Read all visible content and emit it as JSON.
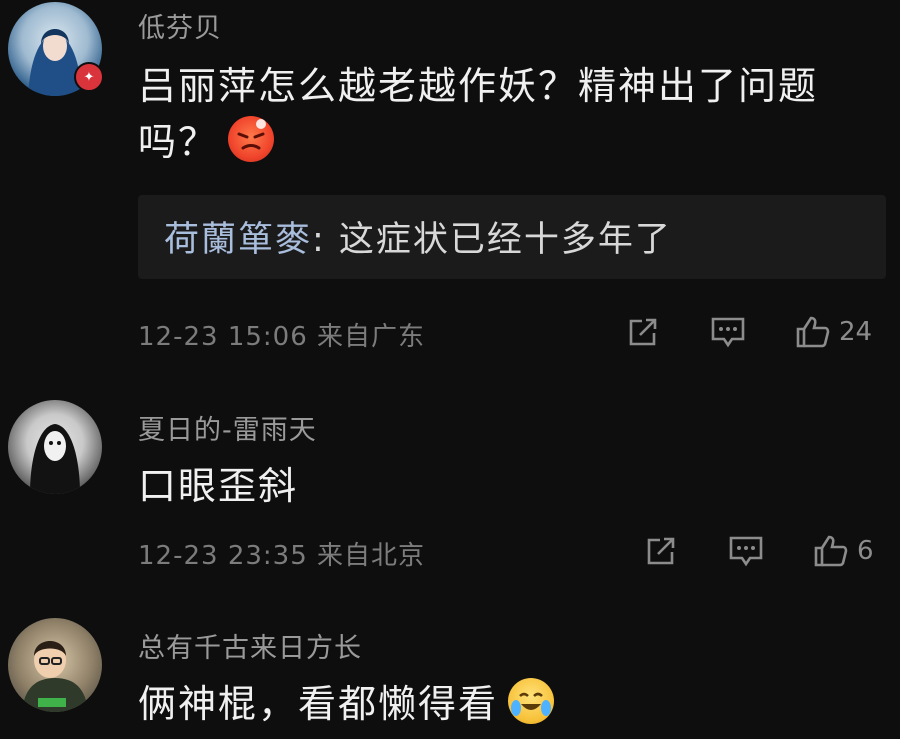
{
  "comments": [
    {
      "username": "低芬贝",
      "content": "吕丽萍怎么越老越作妖？精神出了问题吗？",
      "emoji": "angry-face-emoji",
      "reply": {
        "name": "荷蘭箪麥",
        "text": ": 这症状已经十多年了"
      },
      "time": "12-23 15:06",
      "location": "来自广东",
      "likes": "24"
    },
    {
      "username": "夏日的-雷雨天",
      "content": "口眼歪斜",
      "time": "12-23 23:35",
      "location": "来自北京",
      "likes": "6"
    },
    {
      "username": "总有千古来日方长",
      "content": "俩神棍，看都懒得看",
      "emoji": "crying-laughing-face-emoji"
    }
  ],
  "colors": {
    "background": "#0e0e0f",
    "reply_name": "#a9bddc",
    "badge": "#d9333c"
  }
}
